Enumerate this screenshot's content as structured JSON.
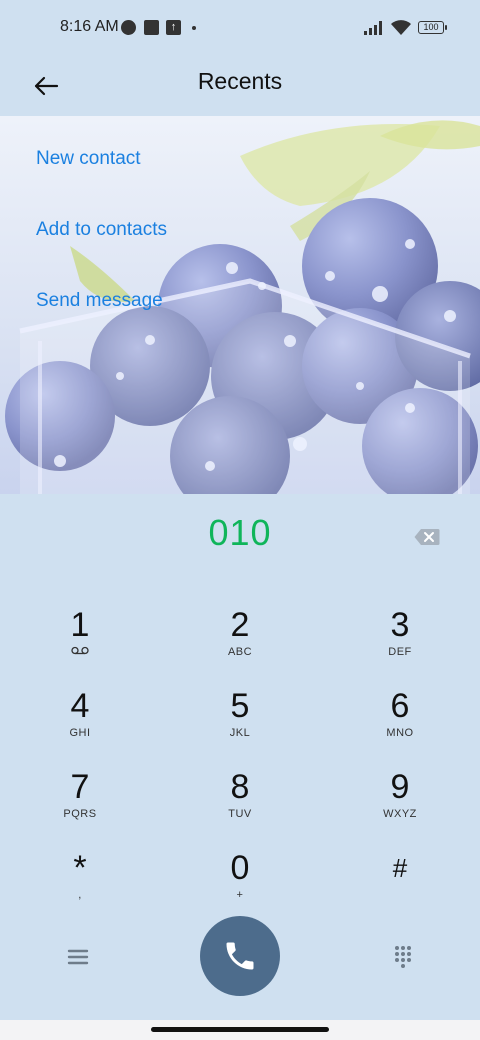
{
  "status_bar": {
    "time": "8:16 AM",
    "battery": "100",
    "icons": [
      "app-notification-icon",
      "square-notification-icon",
      "upload-icon",
      "dot-icon",
      "signal-icon",
      "wifi-icon",
      "battery-icon"
    ]
  },
  "header": {
    "title": "Recents",
    "back_icon": "arrow-left-icon"
  },
  "actions": [
    {
      "label": "New contact"
    },
    {
      "label": "Add to contacts"
    },
    {
      "label": "Send message"
    }
  ],
  "dialer": {
    "number": "010",
    "number_color": "#0fb55a",
    "keys": [
      {
        "digit": "1",
        "letters": "voicemail"
      },
      {
        "digit": "2",
        "letters": "ABC"
      },
      {
        "digit": "3",
        "letters": "DEF"
      },
      {
        "digit": "4",
        "letters": "GHI"
      },
      {
        "digit": "5",
        "letters": "JKL"
      },
      {
        "digit": "6",
        "letters": "MNO"
      },
      {
        "digit": "7",
        "letters": "PQRS"
      },
      {
        "digit": "8",
        "letters": "TUV"
      },
      {
        "digit": "9",
        "letters": "WXYZ"
      },
      {
        "digit": "*",
        "letters": ","
      },
      {
        "digit": "0",
        "letters": "+"
      },
      {
        "digit": "#",
        "letters": ""
      }
    ]
  },
  "bottom_bar": {
    "menu_icon": "menu-icon",
    "call_icon": "phone-icon",
    "call_color": "#4d6c8c",
    "dialpad_icon": "dialpad-icon"
  },
  "colors": {
    "accent": "#1b80e0",
    "background": "#cfe0f0"
  }
}
